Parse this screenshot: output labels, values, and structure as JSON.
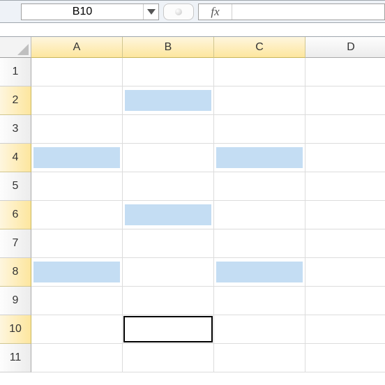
{
  "nameBox": "B10",
  "fxLabel": "fx",
  "formula": "",
  "columns": [
    "A",
    "B",
    "C",
    "D"
  ],
  "rows": [
    "1",
    "2",
    "3",
    "4",
    "5",
    "6",
    "7",
    "8",
    "9",
    "10",
    "11"
  ],
  "highlightedCells": [
    "B2",
    "A4",
    "C4",
    "B6",
    "A8",
    "C8"
  ],
  "highlightedColumnHeaders": [
    "A",
    "B",
    "C"
  ],
  "highlightedRowHeaders": [
    "2",
    "4",
    "6",
    "8",
    "10"
  ],
  "selectedCell": "B10"
}
